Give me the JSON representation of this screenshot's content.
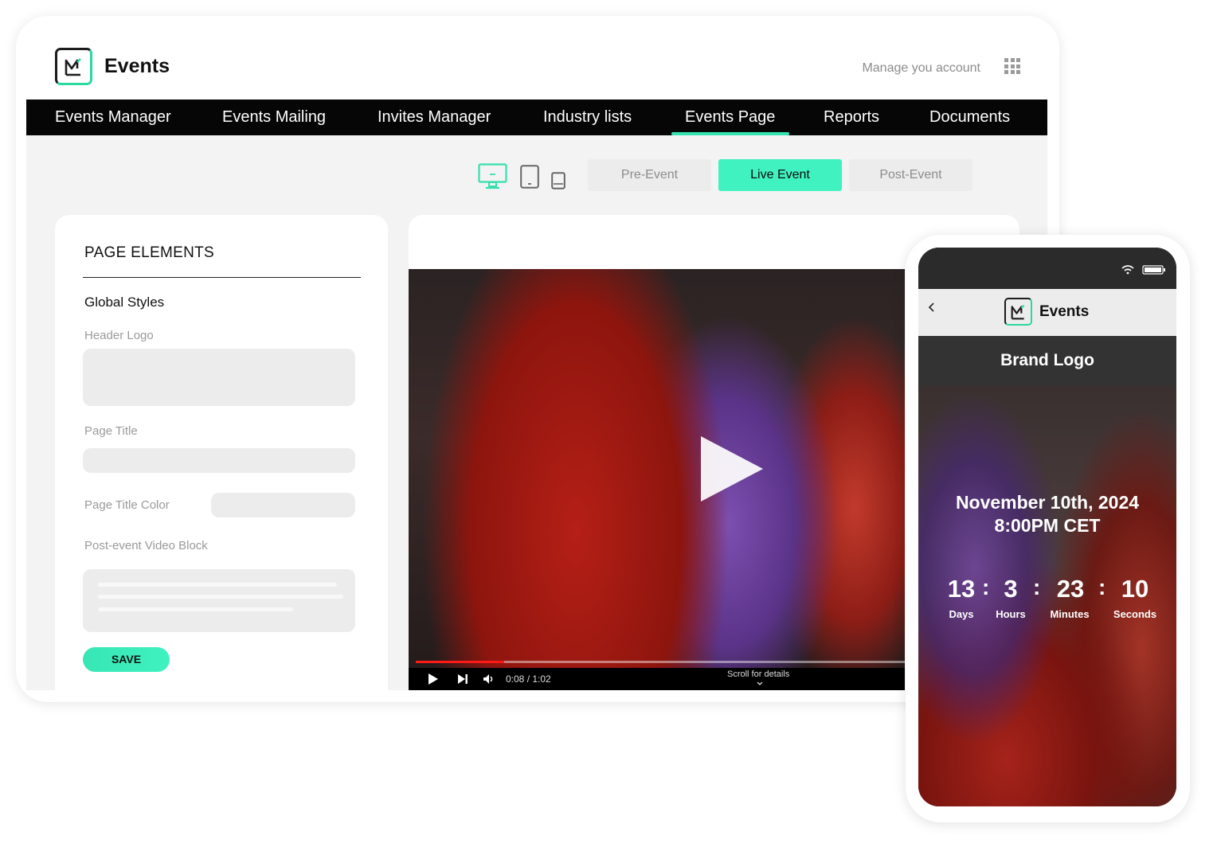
{
  "app": {
    "brand_name": "Events",
    "manage_account": "Manage you account",
    "colors": {
      "accent": "#3ff2c0",
      "nav_bg": "#060606",
      "progress": "#ff1a1a"
    }
  },
  "nav": {
    "items": [
      "Events Manager",
      "Events Mailing",
      "Invites Manager",
      "Industry lists",
      "Events Page",
      "Reports",
      "Documents"
    ],
    "active": "Events Page"
  },
  "toolbar": {
    "devices": [
      "desktop-icon",
      "tablet-icon",
      "mobile-icon"
    ],
    "active_device": "desktop-icon",
    "tabs": [
      "Pre-Event",
      "Live Event",
      "Post-Event"
    ],
    "active_tab": "Live Event"
  },
  "panel": {
    "title": "PAGE ELEMENTS",
    "section": "Global Styles",
    "fields": {
      "header_logo": "Header Logo",
      "page_title": "Page Title",
      "page_title_color": "Page Title Color",
      "video_block": "Post-event Video Block"
    },
    "save": "SAVE"
  },
  "video": {
    "time": "0:08 / 1:02",
    "progress": 0.18,
    "scroll_hint": "Scroll for details"
  },
  "phone": {
    "brand_name": "Events",
    "brand_logo": "Brand Logo",
    "date_line1": "November 10th, 2024",
    "date_line2": "8:00PM CET",
    "countdown": {
      "days": "13",
      "hours": "3",
      "minutes": "23",
      "seconds": "10",
      "days_label": "Days",
      "hours_label": "Hours",
      "minutes_label": "Minutes",
      "seconds_label": "Seconds"
    }
  }
}
